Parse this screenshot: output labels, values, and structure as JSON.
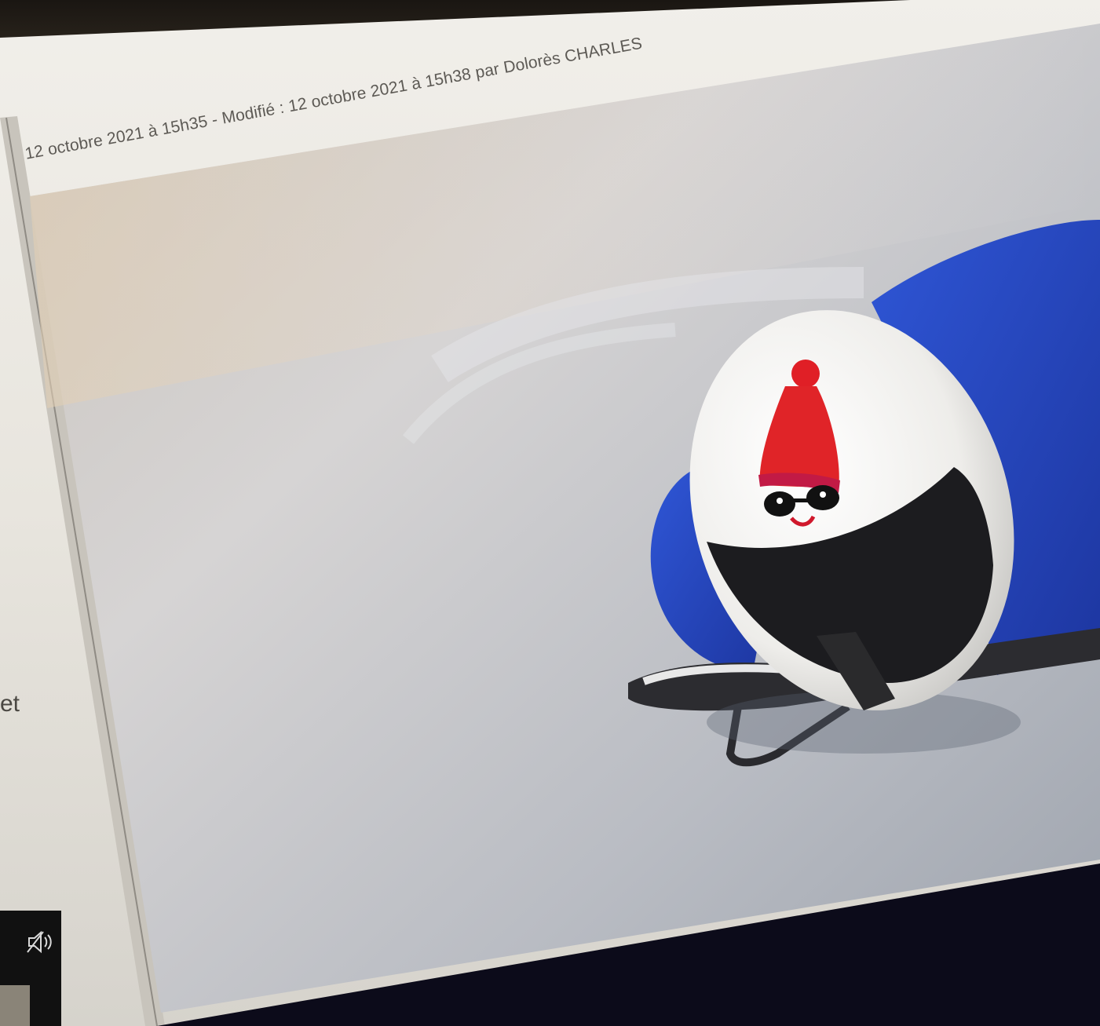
{
  "article": {
    "meta": "12 octobre 2021 à 15h35 - Modifié : 12 octobre 2021 à 15h38 par Dolorès CHARLES",
    "side_fragment": "et"
  },
  "player": {
    "mute_icon": "speaker-muted-icon"
  },
  "colors": {
    "page_bg": "#efede7",
    "dark_bg": "#0e0d1c",
    "suit_blue": "#2443b8",
    "helmet_white": "#f2f1ee",
    "hat_red": "#e02428"
  }
}
